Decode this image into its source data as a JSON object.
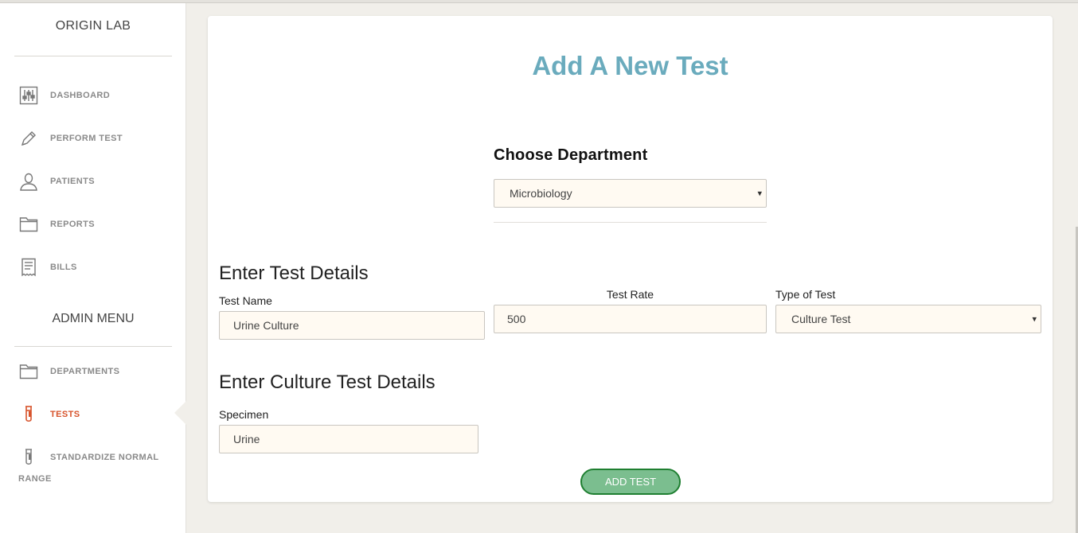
{
  "sidebar": {
    "brand": "ORIGIN LAB",
    "items": [
      {
        "label": "DASHBOARD",
        "icon": "sliders-icon"
      },
      {
        "label": "PERFORM TEST",
        "icon": "pen-icon"
      },
      {
        "label": "PATIENTS",
        "icon": "user-icon"
      },
      {
        "label": "REPORTS",
        "icon": "folder-icon"
      },
      {
        "label": "BILLS",
        "icon": "receipt-icon"
      }
    ],
    "admin_title": "ADMIN MENU",
    "admin_items": [
      {
        "label": "DEPARTMENTS",
        "icon": "folder-icon"
      },
      {
        "label": "TESTS",
        "icon": "test-tube-icon",
        "active": true
      },
      {
        "label": "STANDARDIZE NORMAL",
        "label_line2": "RANGE",
        "icon": "test-tube-icon"
      }
    ]
  },
  "main": {
    "title": "Add A New Test",
    "department": {
      "heading": "Choose Department",
      "selected": "Microbiology"
    },
    "test_details": {
      "heading": "Enter Test Details",
      "test_name_label": "Test Name",
      "test_name_value": "Urine Culture",
      "test_rate_label": "Test Rate",
      "test_rate_value": "500",
      "type_label": "Type of Test",
      "type_selected": "Culture Test"
    },
    "culture_details": {
      "heading": "Enter Culture Test Details",
      "specimen_label": "Specimen",
      "specimen_value": "Urine"
    },
    "submit_label": "ADD TEST"
  },
  "colors": {
    "title": "#6aabbd",
    "active_nav": "#d7532b",
    "button_fill": "#7bbe8f",
    "button_border": "#1f7f31",
    "field_bg": "#fffaf2"
  }
}
